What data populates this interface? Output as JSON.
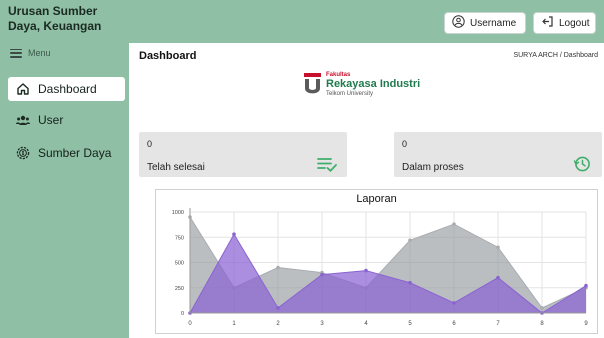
{
  "app": {
    "brand": "Urusan Sumber Daya, Keuangan"
  },
  "sidebar": {
    "menu_label": "Menu",
    "items": [
      {
        "label": "Dashboard",
        "icon": "home-icon",
        "active": true
      },
      {
        "label": "User",
        "icon": "users-icon",
        "active": false
      },
      {
        "label": "Sumber Daya",
        "icon": "money-icon",
        "active": false
      }
    ]
  },
  "header": {
    "username": "Username",
    "logout": "Logout"
  },
  "main": {
    "title": "Dashboard",
    "breadcrumb": "SURYA ARCH / Dashboard",
    "logo": {
      "faculty": "Fakultas",
      "name": "Rekayasa Industri",
      "university": "Telkom University"
    },
    "cards": [
      {
        "count": "0",
        "label": "Telah selesai",
        "icon": "checklist-icon"
      },
      {
        "count": "0",
        "label": "Dalam proses",
        "icon": "clock-history-icon"
      }
    ]
  },
  "colors": {
    "sidebar": "#8fbfa4",
    "accent_green": "#3fae6b",
    "series_gray": "#a9adb1",
    "series_purple": "#8a63d2"
  },
  "chart_data": {
    "type": "area",
    "title": "Laporan",
    "x": [
      0,
      1,
      2,
      3,
      4,
      5,
      6,
      7,
      8,
      9
    ],
    "ylim": [
      0,
      1000
    ],
    "yticks": [
      0,
      250,
      500,
      750,
      1000
    ],
    "grid": true,
    "series": [
      {
        "values": [
          950,
          250,
          450,
          400,
          250,
          720,
          880,
          650,
          50,
          250
        ]
      },
      {
        "values": [
          0,
          780,
          50,
          380,
          420,
          300,
          100,
          350,
          0,
          270
        ]
      }
    ]
  }
}
